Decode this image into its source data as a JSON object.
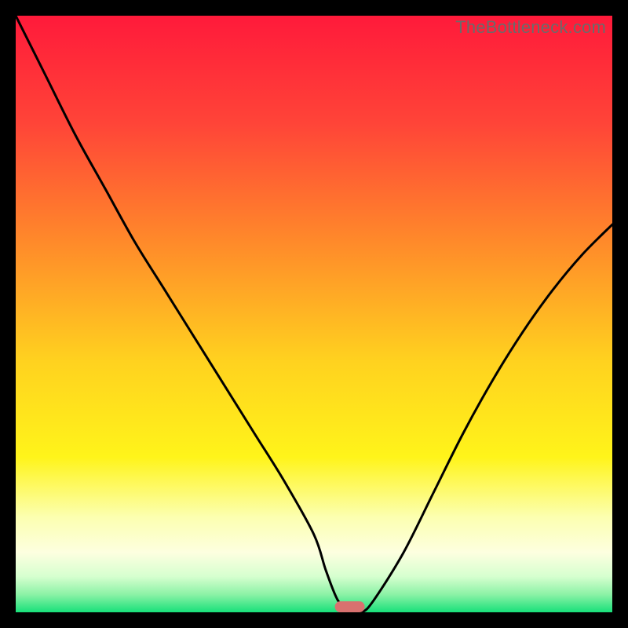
{
  "watermark": "TheBottleneck.com",
  "chart_data": {
    "type": "line",
    "title": "",
    "xlabel": "",
    "ylabel": "",
    "xlim": [
      0,
      100
    ],
    "ylim": [
      0,
      100
    ],
    "x": [
      0,
      5,
      10,
      15,
      20,
      25,
      30,
      35,
      40,
      45,
      50,
      52,
      54,
      56,
      58,
      60,
      65,
      70,
      75,
      80,
      85,
      90,
      95,
      100
    ],
    "values": [
      100,
      90,
      80,
      71,
      62,
      54,
      46,
      38,
      30,
      22,
      13,
      7,
      2,
      0,
      0,
      2,
      10,
      20,
      30,
      39,
      47,
      54,
      60,
      65
    ],
    "minimum_marker": {
      "x_center": 56,
      "width": 5,
      "color": "#d9716f"
    },
    "gradient_stops": [
      {
        "pos": 0.0,
        "color": "#ff1a3a"
      },
      {
        "pos": 0.18,
        "color": "#ff4438"
      },
      {
        "pos": 0.38,
        "color": "#ff8a2a"
      },
      {
        "pos": 0.58,
        "color": "#ffd21f"
      },
      {
        "pos": 0.74,
        "color": "#fff41a"
      },
      {
        "pos": 0.84,
        "color": "#fcffb0"
      },
      {
        "pos": 0.9,
        "color": "#fdffe0"
      },
      {
        "pos": 0.94,
        "color": "#d6ffcf"
      },
      {
        "pos": 0.97,
        "color": "#8cf2a6"
      },
      {
        "pos": 1.0,
        "color": "#18e07a"
      }
    ]
  }
}
